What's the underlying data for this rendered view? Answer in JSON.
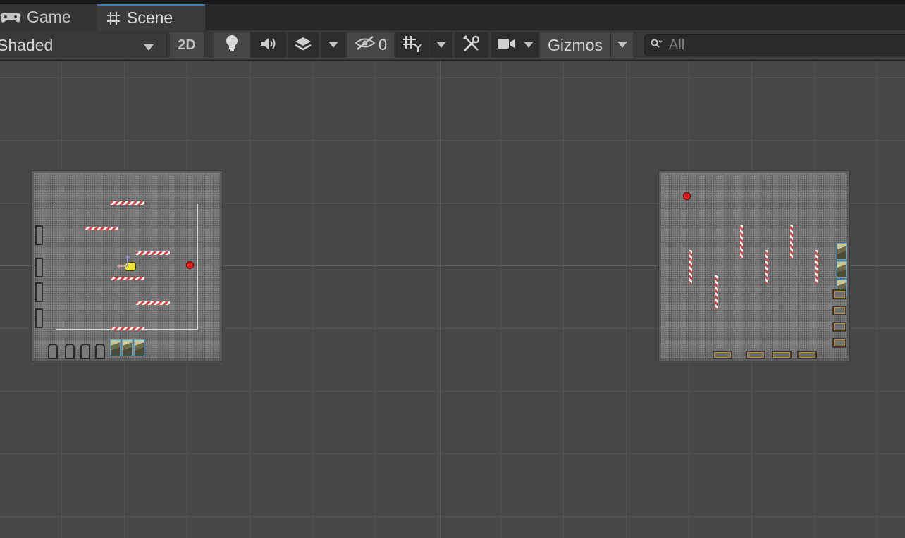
{
  "tabs": {
    "game_label": "Game",
    "scene_label": "Scene",
    "game_icon": "gamepad-icon",
    "scene_icon": "hash-icon"
  },
  "toolbar": {
    "draw_mode": "Shaded",
    "mode_2d": "2D",
    "hidden_count": "0",
    "gizmos_label": "Gizmos",
    "icons": [
      "lightbulb-icon",
      "audio-icon",
      "effects-icon",
      "hidden-objects-icon",
      "grid-icon",
      "tools-icon",
      "camera-icon"
    ]
  },
  "search": {
    "placeholder": "All"
  },
  "scene": {
    "axis_color": "#5e5e5e",
    "barrier_colors": [
      "#d04a4a",
      "#f4f4f4"
    ],
    "marker_color": "#e02020",
    "player_color": "#e6e036"
  }
}
